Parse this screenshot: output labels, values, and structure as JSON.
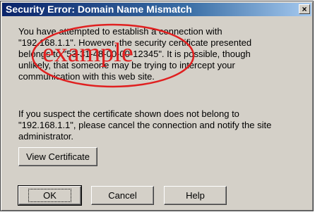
{
  "dialog": {
    "title": "Security Error: Domain Name Mismatch",
    "close_label": "×",
    "message1": [
      "You have attempted to establish a connection with",
      "\"192.168.1.1\". However, the security certificate presented",
      "belongs to \"53-31-48-00-00-12345\". It is possible, though",
      "unlikely, that someone may be trying to intercept your",
      "communication with this web site."
    ],
    "message2": [
      "If you suspect the certificate shown does not belong to",
      "\"192.168.1.1\", please cancel the connection and notify the site",
      "administrator."
    ],
    "buttons": {
      "view_certificate": "View Certificate",
      "ok": "OK",
      "cancel": "Cancel",
      "help": "Help"
    }
  },
  "watermark": {
    "text": "example",
    "color": "#e02020"
  },
  "colors": {
    "titlebar_start": "#0a246a",
    "titlebar_end": "#a6caf0",
    "face": "#d4d0c8"
  }
}
